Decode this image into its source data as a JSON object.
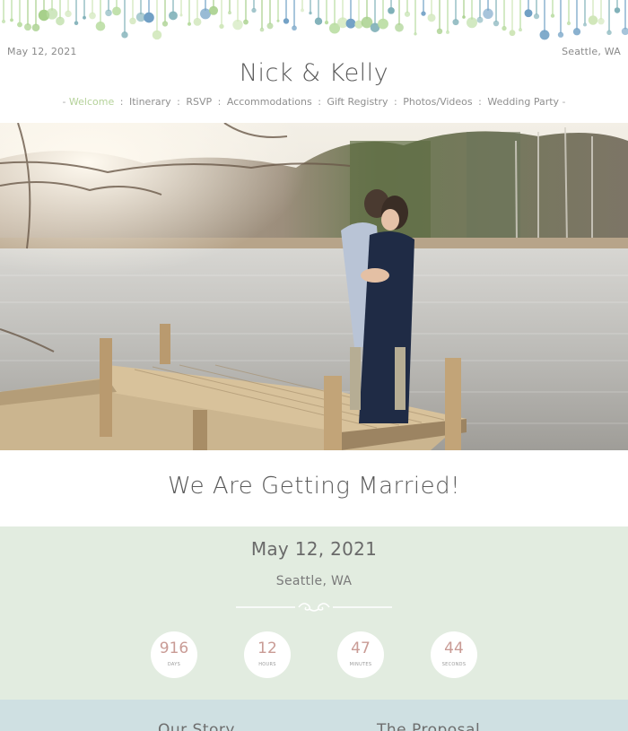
{
  "header": {
    "date": "May 12, 2021",
    "location": "Seattle, WA",
    "names": "Nick & Kelly"
  },
  "nav": {
    "items": [
      {
        "label": "Welcome",
        "active": true
      },
      {
        "label": "Itinerary"
      },
      {
        "label": "RSVP"
      },
      {
        "label": "Accommodations"
      },
      {
        "label": "Gift Registry"
      },
      {
        "label": "Photos/Videos"
      },
      {
        "label": "Wedding Party"
      }
    ]
  },
  "hero": {
    "announcement": "We Are Getting Married!"
  },
  "countdown": {
    "date": "May 12, 2021",
    "location": "Seattle, WA",
    "units": [
      {
        "value": "916",
        "label": "DAYS"
      },
      {
        "value": "12",
        "label": "HOURS"
      },
      {
        "value": "47",
        "label": "MINUTES"
      },
      {
        "value": "44",
        "label": "SECONDS"
      }
    ]
  },
  "story": {
    "left_heading": "Our Story",
    "right_heading": "The Proposal"
  },
  "colors": {
    "accent_green": "#b5d29a",
    "countdown_bg": "#e2ece0",
    "story_bg": "#cfe0e2",
    "number_color": "#c99b95"
  }
}
